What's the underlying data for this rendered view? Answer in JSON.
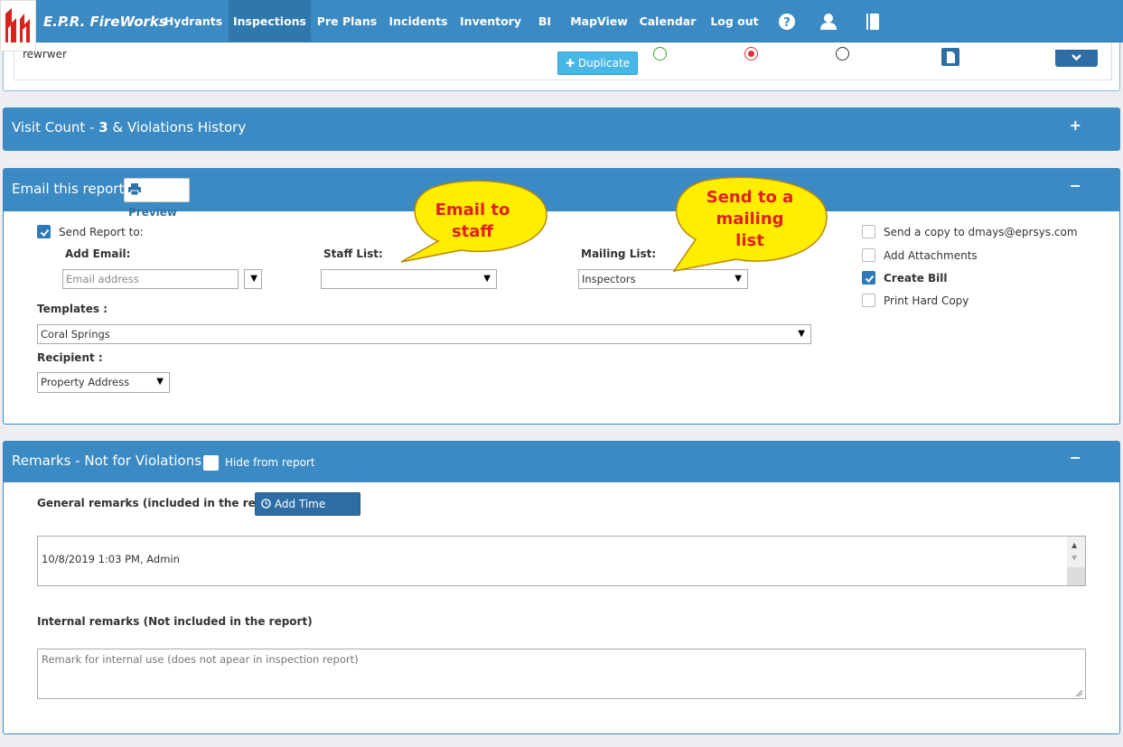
{
  "nav": {
    "brand": "E.P.R. FireWorks",
    "items": [
      "Hydrants",
      "Inspections",
      "Pre Plans",
      "Incidents",
      "Inventory",
      "BI",
      "MapView",
      "Calendar",
      "Log out"
    ],
    "active": "Inspections",
    "icons": [
      "help-icon",
      "user-icon",
      "book-icon"
    ]
  },
  "top_row": {
    "text": "rewrwer",
    "duplicate_label": "Duplicate"
  },
  "visit_panel": {
    "title_prefix": "Visit Count - ",
    "count": "3",
    "title_suffix": " & Violations History",
    "toggle": "+"
  },
  "email_panel": {
    "title": "Email this report",
    "preview_label": "Preview",
    "toggle": "−",
    "send_report_label": "Send Report to:",
    "add_email_label": "Add Email:",
    "email_placeholder": "Email address",
    "staff_list_label": "Staff List:",
    "staff_list_value": "",
    "mailing_list_label": "Mailing List:",
    "mailing_list_value": "Inspectors",
    "templates_label": "Templates :",
    "templates_value": "Coral Springs",
    "recipient_label": "Recipient :",
    "recipient_value": "Property Address",
    "options": [
      {
        "label": "Send a copy to dmays@eprsys.com",
        "checked": false
      },
      {
        "label": "Add Attachments",
        "checked": false
      },
      {
        "label": "Create Bill",
        "checked": true
      },
      {
        "label": "Print Hard Copy",
        "checked": false
      }
    ],
    "callout_staff": [
      "Email to",
      "staff"
    ],
    "callout_mailing": [
      "Send to a",
      "mailing",
      "list"
    ]
  },
  "remarks_panel": {
    "title": "Remarks - Not for Violations",
    "hide_label": "Hide from report",
    "toggle": "−",
    "general_label": "General remarks (included in the report)",
    "timestamp_label": "Add Time Stamp",
    "general_value": "10/8/2019 1:03 PM, Admin",
    "internal_label": "Internal remarks (Not included in the report)",
    "internal_placeholder": "Remark for internal use (does not apear in inspection report)"
  },
  "colors": {
    "primary": "#3b8ac3",
    "callout_fill": "#ffee00",
    "callout_text": "#e02020"
  }
}
